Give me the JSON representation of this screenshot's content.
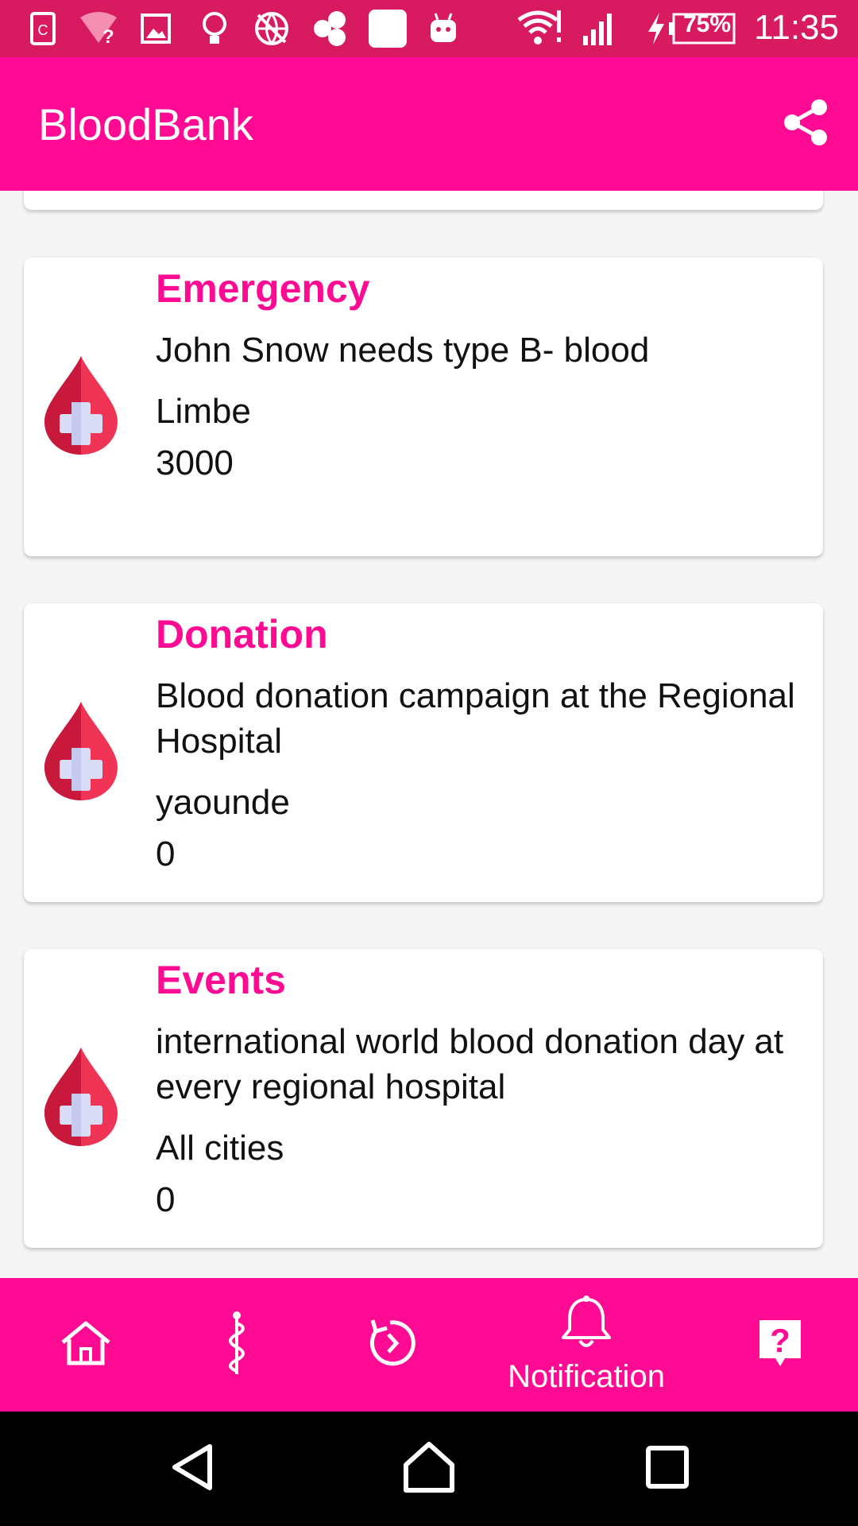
{
  "status_bar": {
    "time": "11:35",
    "battery": "75%",
    "icons": [
      "sim-icon",
      "wifi-question-icon",
      "image-icon",
      "bulb-icon",
      "globe-blocked-icon",
      "hexagons-icon",
      "square-icon",
      "android-icon",
      "wifi-alert-icon",
      "cell-signal-icon",
      "charging-icon",
      "battery-icon"
    ]
  },
  "app_bar": {
    "title": "BloodBank",
    "share_icon": "share-icon"
  },
  "cards": [
    {
      "title": "Emergency",
      "description": "John Snow needs type B- blood",
      "city": "Limbe",
      "amount": "3000"
    },
    {
      "title": "Donation",
      "description": "Blood donation campaign at the Regional Hospital",
      "city": "yaounde",
      "amount": "0"
    },
    {
      "title": "Events",
      "description": "international world blood donation day at every regional hospital",
      "city": "All cities",
      "amount": "0"
    }
  ],
  "colors": {
    "status_bar": "#d81b60",
    "primary": "#ff0a93",
    "accent_text": "#ff0a93",
    "drop_red": "#ef3455",
    "drop_dark": "#c8193c",
    "cross": "#d9dcf5"
  },
  "bottom_nav": {
    "items": [
      {
        "icon": "home-icon",
        "label": ""
      },
      {
        "icon": "caduceus-icon",
        "label": ""
      },
      {
        "icon": "history-icon",
        "label": ""
      },
      {
        "icon": "bell-icon",
        "label": "Notification"
      },
      {
        "icon": "help-icon",
        "label": ""
      }
    ],
    "active": "Notification"
  },
  "system_nav": {
    "items": [
      "back-icon",
      "home-circle-icon",
      "recents-icon"
    ]
  }
}
